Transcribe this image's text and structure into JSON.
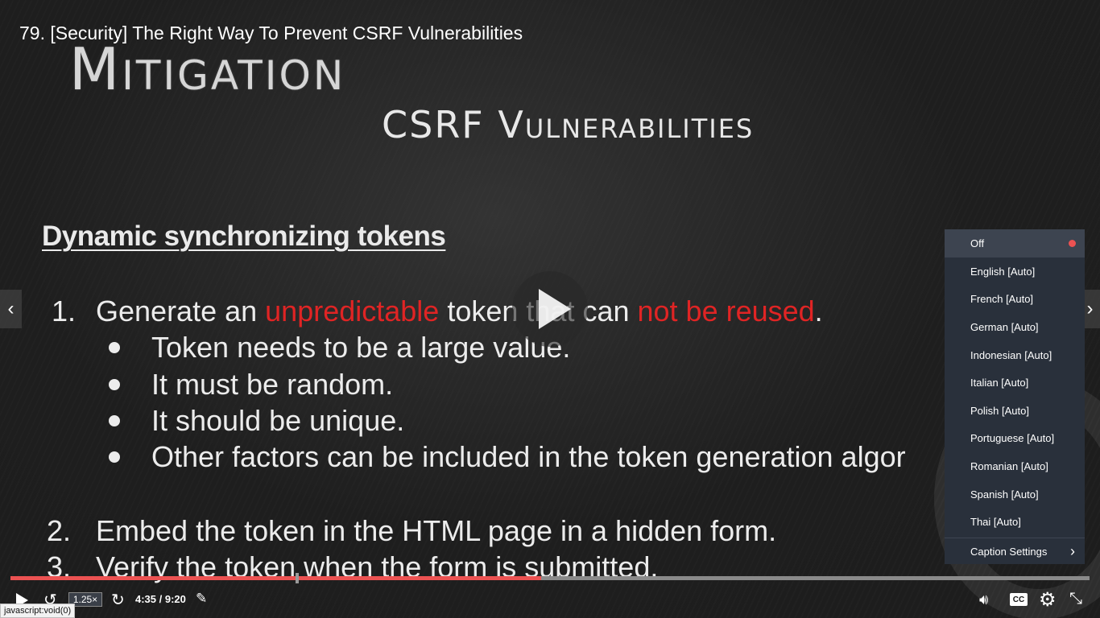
{
  "lecture": {
    "title": "79. [Security] The Right Way To Prevent CSRF Vulnerabilities"
  },
  "slide": {
    "heading": "Mitigation",
    "subheading": "CSRF Vulnerabilities",
    "section_title": "Dynamic synchronizing tokens",
    "item1": {
      "number": "1.",
      "parts": [
        "Generate an ",
        "unpredictable",
        " token that can ",
        "not be reused",
        "."
      ],
      "bullets": [
        "Token needs to be a large value.",
        "It must be random.",
        "It should be unique.",
        "Other factors can be included in the token generation algor"
      ]
    },
    "item2": {
      "number": "2.",
      "text": "Embed the token in the HTML page in a hidden form."
    },
    "item3": {
      "number": "3.",
      "text": "Verify the token when the form is submitted."
    }
  },
  "captions_menu": {
    "options": [
      {
        "label": "Off",
        "selected": true
      },
      {
        "label": "English [Auto]"
      },
      {
        "label": "French [Auto]"
      },
      {
        "label": "German [Auto]"
      },
      {
        "label": "Indonesian [Auto]"
      },
      {
        "label": "Italian [Auto]"
      },
      {
        "label": "Polish [Auto]"
      },
      {
        "label": "Portuguese [Auto]"
      },
      {
        "label": "Romanian [Auto]"
      },
      {
        "label": "Spanish [Auto]"
      },
      {
        "label": "Thai [Auto]"
      }
    ],
    "settings_label": "Caption Settings"
  },
  "player": {
    "speed": "1.25×",
    "time": "4:35 / 9:20",
    "progress_fraction": 0.492,
    "buffered_handle_fraction": 0.264,
    "cc_label": "CC",
    "accent_color": "#ec5252"
  },
  "icons": {
    "play": "play-icon",
    "rewind": "rewind-icon",
    "forward": "forward-icon",
    "notes": "notes-icon",
    "volume": "volume-icon",
    "settings": "gear-icon",
    "fullscreen": "exit-fullscreen-icon",
    "prev": "chevron-left-icon",
    "next": "chevron-right-icon"
  },
  "status_bar": {
    "text": "javascript:void(0)"
  }
}
